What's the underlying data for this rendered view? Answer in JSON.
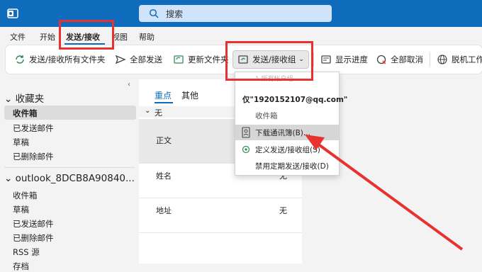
{
  "titlebar": {
    "search_placeholder": "搜索"
  },
  "menu": {
    "tabs": [
      "文件",
      "开始",
      "发送/接收",
      "视图",
      "帮助"
    ]
  },
  "ribbon": {
    "send_receive_all": "发送/接收所有文件夹",
    "send_all": "全部发送",
    "update_folder": "更新文件夹",
    "send_receive_groups": "发送/接收组",
    "show_progress": "显示进度",
    "cancel_all": "全部取消",
    "offline": "脱机工作"
  },
  "sidebar": {
    "favorites_label": "收藏夹",
    "favorites": [
      "收件箱",
      "已发送邮件",
      "草稿",
      "已删除邮件"
    ],
    "account_label": "outlook_8DCB8A90840...",
    "account_folders": [
      "收件箱",
      "草稿",
      "已发送邮件",
      "已删除邮件",
      "RSS 源",
      "存档"
    ]
  },
  "list": {
    "tabs": [
      "重点",
      "其他"
    ],
    "group_header": "无",
    "rows": [
      {
        "label": "正文",
        "value": ""
      },
      {
        "label": "姓名",
        "value": "无"
      },
      {
        "label": "地址",
        "value": "无"
      }
    ]
  },
  "dropdown": {
    "faded_header": "1 所有帐户组",
    "account": "仅\"1920152107@qq.com\"",
    "inbox": "收件箱",
    "download_address_book": "下载通讯簿(B)...",
    "define_groups": "定义发送/接收组(S)",
    "disable_scheduled": "禁用定期发送/接收(D)"
  },
  "colors": {
    "brand": "#0f6cbd",
    "annotation_red": "#e8322f",
    "hover": "#d6d6d6"
  }
}
